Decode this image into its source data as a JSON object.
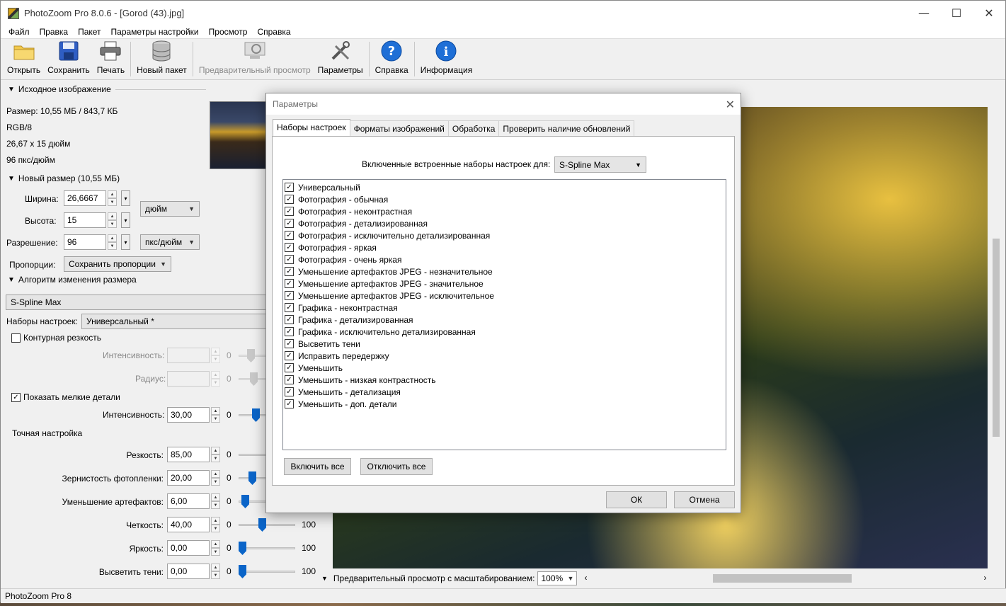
{
  "window": {
    "title": "PhotoZoom Pro 8.0.6 - [Gorod  (43).jpg]",
    "minimize": "—",
    "maximize": "☐",
    "close": "✕"
  },
  "menu": [
    "Файл",
    "Правка",
    "Пакет",
    "Параметры настройки",
    "Просмотр",
    "Справка"
  ],
  "toolbar": {
    "open": "Открыть",
    "save": "Сохранить",
    "print": "Печать",
    "new_batch": "Новый пакет",
    "preview": "Предварительный просмотр",
    "settings": "Параметры",
    "help": "Справка",
    "info": "Информация"
  },
  "source": {
    "header": "Исходное изображение",
    "size": "Размер: 10,55 МБ / 843,7 КБ",
    "mode": "RGB/8",
    "dims": "26,67 x 15 дюйм",
    "res": "96 пкс/дюйм"
  },
  "new_size": {
    "header": "Новый размер (10,55 МБ)",
    "width_label": "Ширина:",
    "width": "26,6667",
    "height_label": "Высота:",
    "height": "15",
    "unit": "дюйм",
    "res_label": "Разрешение:",
    "res": "96",
    "res_unit": "пкс/дюйм",
    "prop_label": "Пропорции:",
    "prop_value": "Сохранить пропорции"
  },
  "algorithm": {
    "header": "Алгоритм изменения размера",
    "method": "S-Spline Max",
    "presets_label": "Наборы настроек:",
    "presets_value": "Универсальный *",
    "contour_label": "Контурная резкость",
    "intensity_label": "Интенсивность:",
    "intensity_zero": "0",
    "radius_label": "Радиус:",
    "radius_zero": "0",
    "details_label": "Показать мелкие детали",
    "details_intensity_label": "Интенсивность:",
    "details_intensity": "30,00",
    "details_zero": "0"
  },
  "fine": {
    "header": "Точная настройка",
    "rows": [
      {
        "label": "Резкость:",
        "value": "85,00",
        "min": "0",
        "max": "",
        "level": 0.85
      },
      {
        "label": "Зернистость фотопленки:",
        "value": "20,00",
        "min": "0",
        "max": "",
        "level": 0.2
      },
      {
        "label": "Уменьшение артефактов:",
        "value": "6,00",
        "min": "0",
        "max": "",
        "level": 0.06
      },
      {
        "label": "Четкость:",
        "value": "40,00",
        "min": "0",
        "max": "100",
        "level": 0.4
      },
      {
        "label": "Яркость:",
        "value": "0,00",
        "min": "0",
        "max": "100",
        "level": 0.0
      },
      {
        "label": "Высветить тени:",
        "value": "0,00",
        "min": "0",
        "max": "100",
        "level": 0.0
      }
    ]
  },
  "preview_bar": {
    "label": "Предварительный просмотр с масштабированием:",
    "zoom": "100%"
  },
  "status": "PhotoZoom Pro 8",
  "dialog": {
    "title": "Параметры",
    "tabs": [
      "Наборы настроек",
      "Форматы изображений",
      "Обработка",
      "Проверить наличие обновлений"
    ],
    "presets_for": "Включенные встроенные наборы настроек для:",
    "presets_method": "S-Spline Max",
    "presets": [
      "Универсальный",
      "Фотография - обычная",
      "Фотография - неконтрастная",
      "Фотография - детализированная",
      "Фотография - исключительно детализированная",
      "Фотография - яркая",
      "Фотография - очень яркая",
      "Уменьшение артефактов JPEG - незначительное",
      "Уменьшение артефактов JPEG - значительное",
      "Уменьшение артефактов JPEG - исключительное",
      "Графика - неконтрастная",
      "Графика - детализированная",
      "Графика - исключительно детализированная",
      "Высветить тени",
      "Исправить передержку",
      "Уменьшить",
      "Уменьшить - низкая контрастность",
      "Уменьшить - детализация",
      "Уменьшить - доп. детали"
    ],
    "enable_all": "Включить все",
    "disable_all": "Отключить все",
    "ok": "ОК",
    "cancel": "Отмена"
  }
}
